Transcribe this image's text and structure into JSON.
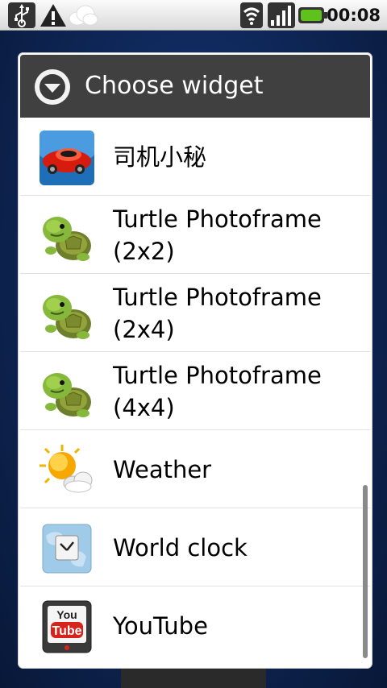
{
  "status_bar": {
    "time": "00:08",
    "icons": [
      "usb-icon",
      "warning-icon",
      "cloud-icon",
      "wifi-icon",
      "signal-icon",
      "battery-icon"
    ]
  },
  "dialog": {
    "title": "Choose widget",
    "header_icon": "chevron-down-icon"
  },
  "widgets": [
    {
      "label": "司机小秘",
      "icon": "red-car-icon"
    },
    {
      "label": "Turtle Photoframe\n(2x2)",
      "icon": "turtle-icon"
    },
    {
      "label": "Turtle Photoframe\n(2x4)",
      "icon": "turtle-icon"
    },
    {
      "label": "Turtle Photoframe\n(4x4)",
      "icon": "turtle-icon"
    },
    {
      "label": "Weather",
      "icon": "weather-icon"
    },
    {
      "label": "World clock",
      "icon": "world-clock-icon"
    },
    {
      "label": "YouTube",
      "icon": "youtube-icon"
    }
  ],
  "colors": {
    "header_bg": "#404040",
    "battery": "#5fc21c",
    "background": "#102a5e"
  }
}
